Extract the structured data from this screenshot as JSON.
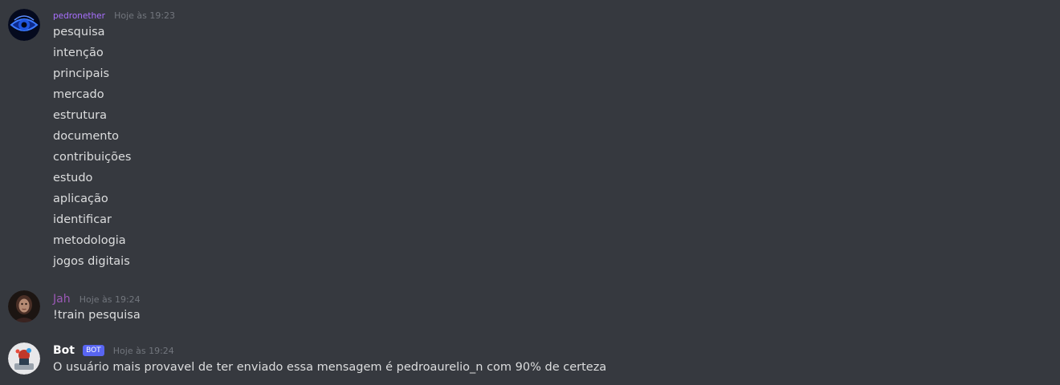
{
  "messages": [
    {
      "author": "pedronether",
      "author_color": "#a970ff",
      "timestamp": "Hoje às 19:23",
      "lines": [
        "pesquisa",
        "intenção",
        "principais",
        "mercado",
        "estrutura",
        "documento",
        "contribuições",
        "estudo",
        "aplicação",
        "identificar",
        "metodologia",
        "jogos digitais"
      ]
    },
    {
      "author": "Jah",
      "author_color": "#9b59b6",
      "timestamp": "Hoje às 19:24",
      "lines": [
        "!train pesquisa"
      ]
    },
    {
      "author": "Bot",
      "author_color": "#ffffff",
      "bot_tag": "BOT",
      "timestamp": "Hoje às 19:24",
      "lines": [
        "O usuário mais provavel de ter enviado essa mensagem é pedroaurelio_n com 90% de certeza"
      ]
    }
  ]
}
